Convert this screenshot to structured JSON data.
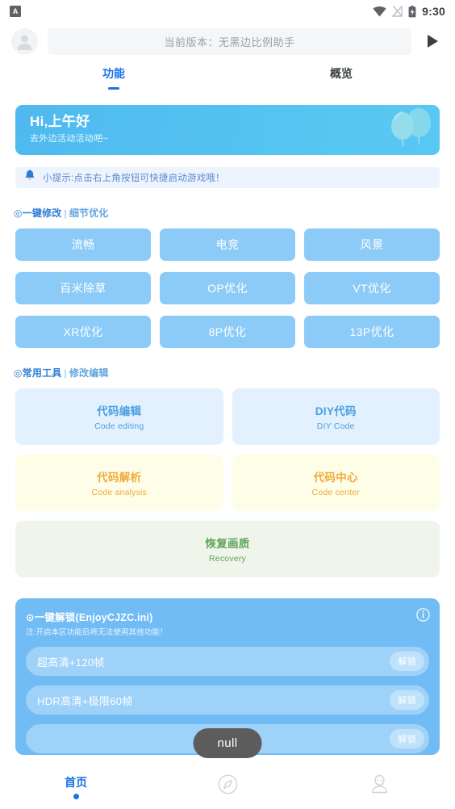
{
  "status_bar": {
    "app_badge": "A",
    "time": "9:30",
    "icons": [
      "wifi-icon",
      "signal-off-icon",
      "battery-charging-icon"
    ]
  },
  "top_bar": {
    "avatar": "user-avatar-icon",
    "search_value": "当前版本：无黑边比例助手",
    "launch_icon": "play-icon"
  },
  "tabs": [
    {
      "label": "功能",
      "active": true
    },
    {
      "label": "概览",
      "active": false
    }
  ],
  "banner": {
    "greeting": "Hi,上午好",
    "subtitle": "去外边活动活动吧~",
    "decoration": "balloons-icon",
    "color": "#54c3f1"
  },
  "tip": {
    "icon": "bell-icon",
    "text": "小提示:点击右上角按钮可快捷启动游戏哦！"
  },
  "sections": [
    {
      "mark": "◎",
      "title": "一键修改",
      "separator": "|",
      "subtitle": "细节优化"
    },
    {
      "mark": "◎",
      "title": "常用工具",
      "separator": "|",
      "subtitle": "修改编辑"
    }
  ],
  "quick_buttons": [
    "流畅",
    "电竞",
    "风景",
    "百米除草",
    "OP优化",
    "VT优化",
    "XR优化",
    "8P优化",
    "13P优化"
  ],
  "tool_cards": [
    {
      "title": "代码编辑",
      "subtitle": "Code editing",
      "theme": "blue"
    },
    {
      "title": "DIY代码",
      "subtitle": "DIY Code",
      "theme": "blue"
    },
    {
      "title": "代码解析",
      "subtitle": "Code analysis",
      "theme": "yellow"
    },
    {
      "title": "代码中心",
      "subtitle": "Code center",
      "theme": "yellow"
    },
    {
      "title": "恢复画质",
      "subtitle": "Recovery",
      "theme": "green"
    }
  ],
  "unlock_panel": {
    "title": "⊙一键解锁(EnjoyCJZC.ini)",
    "note": "注:开启本区功能后将无法使用其他功能！",
    "info_icon": "info-icon",
    "rows": [
      {
        "name": "超高清+120帧",
        "button": "解锁"
      },
      {
        "name": "HDR高清+极限60帧",
        "button": "解锁"
      },
      {
        "name": "",
        "button": "解锁"
      }
    ]
  },
  "toast": {
    "message": "null"
  },
  "bottom_nav": [
    {
      "label": "首页",
      "icon": "home-dot-icon",
      "active": true
    },
    {
      "label": "",
      "icon": "compass-icon",
      "active": false
    },
    {
      "label": "",
      "icon": "person-icon",
      "active": false
    }
  ]
}
